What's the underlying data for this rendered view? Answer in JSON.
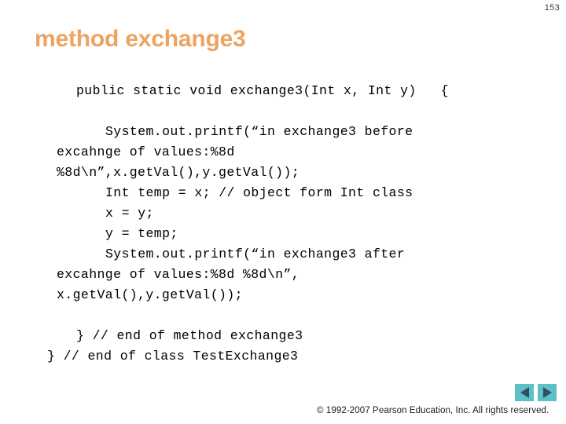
{
  "slide": {
    "page_number": "153",
    "title": "method exchange3",
    "code_lines": [
      {
        "indent": 2,
        "text": "public static void exchange3(Int x, Int y)   {"
      },
      {
        "indent": 0,
        "text": ""
      },
      {
        "indent": 3,
        "text": "System.out.printf(“in exchange3 before"
      },
      {
        "indent": 1,
        "text": "excahnge of values:%8d"
      },
      {
        "indent": 1,
        "text": "%8d\\n”,x.getVal(),y.getVal());"
      },
      {
        "indent": 3,
        "text": "Int temp = x; // object form Int class"
      },
      {
        "indent": 3,
        "text": "x = y;"
      },
      {
        "indent": 3,
        "text": "y = temp;"
      },
      {
        "indent": 3,
        "text": "System.out.printf(“in exchange3 after"
      },
      {
        "indent": 1,
        "text": "excahnge of values:%8d %8d\\n”,"
      },
      {
        "indent": 1,
        "text": "x.getVal(),y.getVal());"
      },
      {
        "indent": 0,
        "text": ""
      },
      {
        "indent": 2,
        "text": "} // end of method exchange3"
      },
      {
        "indent": 0,
        "text": "} // end of class TestExchange3"
      }
    ],
    "footer": {
      "copyright": "© 1992-2007 Pearson Education, Inc.  All rights reserved.",
      "nav_previous_label": "Previous slide",
      "nav_next_label": "Next slide"
    },
    "colors": {
      "title": "#eda361",
      "nav_button_bg": "#5cc0c8",
      "nav_arrow": "#31505e",
      "code_text": "#000000",
      "background": "#ffffff"
    }
  }
}
